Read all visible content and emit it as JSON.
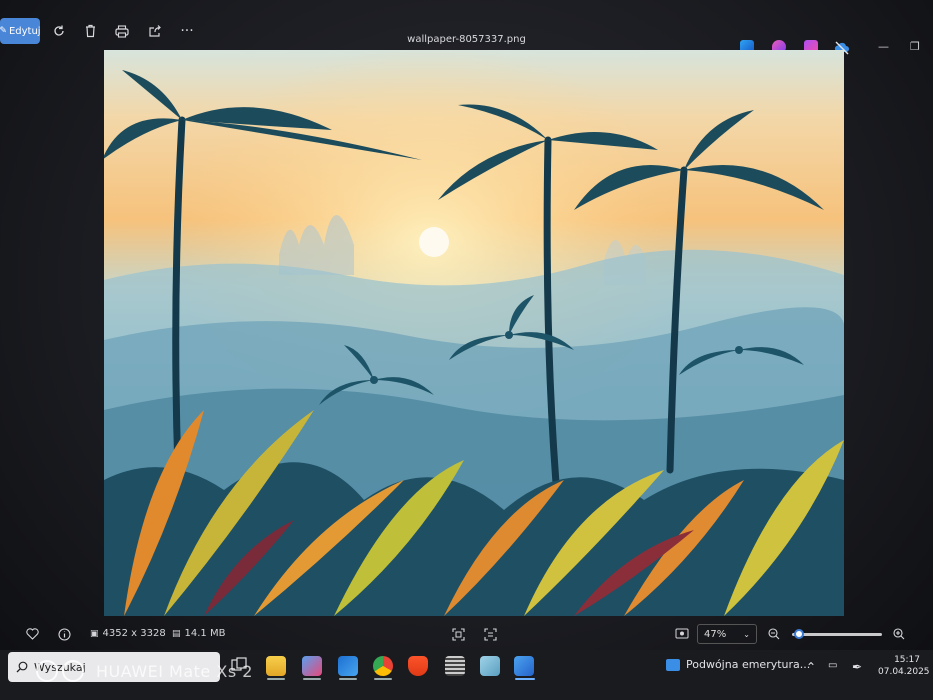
{
  "window": {
    "file_name": "wallpaper-8057337.png",
    "controls": {
      "minimize": "—",
      "restore": "❐"
    }
  },
  "toolbar": {
    "edit_label": "Edytuj",
    "more_label": "···",
    "icons": [
      "rotate-icon",
      "delete-icon",
      "print-icon",
      "share-icon",
      "more-icon"
    ],
    "apps": [
      "designer-icon",
      "clipchamp-icon",
      "photos-ai-icon",
      "cloud-off-icon"
    ]
  },
  "status": {
    "dimensions": "4352 x 3328",
    "file_size": "14.1 MB",
    "zoom": "47%",
    "zoom_fraction": 0.08
  },
  "taskbar": {
    "search_placeholder": "Wyszukaj",
    "notification": "Podwójna emerytura...",
    "time": "15:17",
    "date": "07.04.2025"
  },
  "overlay": {
    "device_watermark": "HUAWEI Mate Xs 2"
  },
  "colors": {
    "accent": "#4a86d8",
    "taskbar": "#1a1b1f",
    "edit_button": "#4a86d8"
  }
}
